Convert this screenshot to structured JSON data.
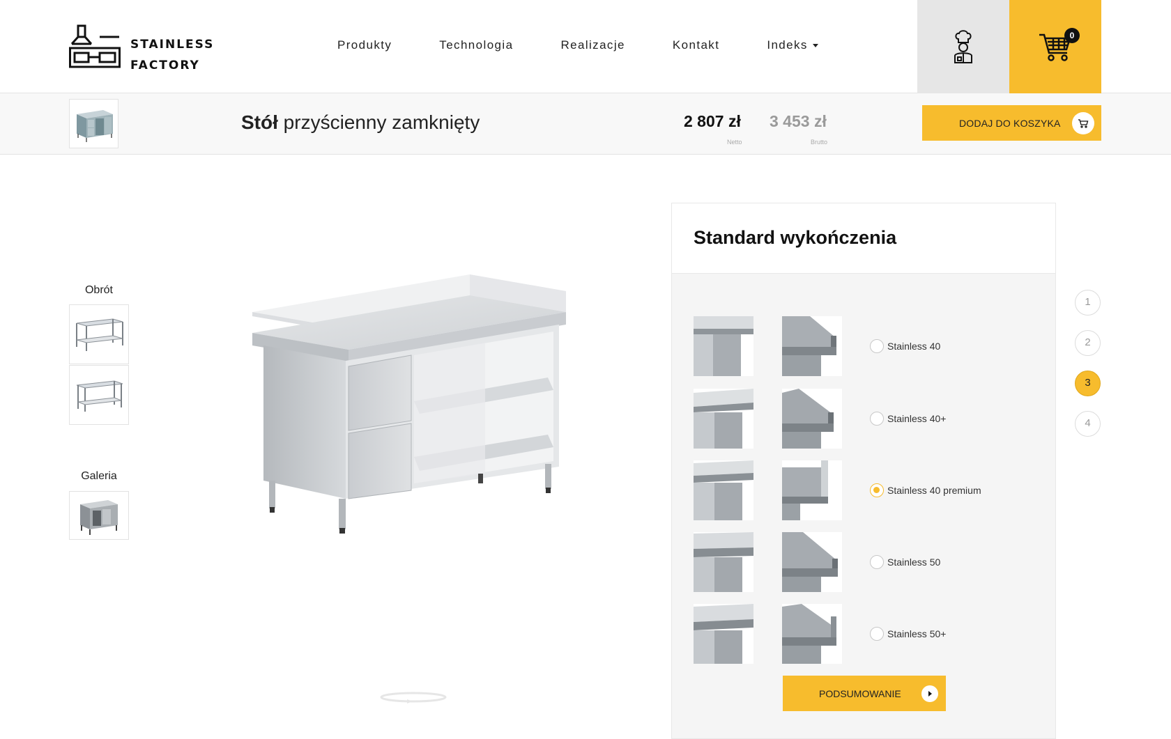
{
  "brand": {
    "name_line1": "STAINLESS",
    "name_line2": "FACTORY",
    "logo_icon": "kitchen-hood-logo"
  },
  "nav": {
    "items": [
      {
        "label": "Produkty"
      },
      {
        "label": "Technologia"
      },
      {
        "label": "Realizacje"
      },
      {
        "label": "Kontakt"
      },
      {
        "label": "Indeks",
        "has_dropdown": true
      }
    ]
  },
  "header": {
    "user_icon": "chef-icon",
    "cart_icon": "cart-icon",
    "cart_count": "0"
  },
  "product": {
    "title_bold": "Stół",
    "title_rest": "przyścienny zamknięty",
    "price_net": "2 807 zł",
    "price_net_label": "Netto",
    "price_gross": "3 453 zł",
    "price_gross_label": "Brutto",
    "add_to_cart_label": "DODAJ DO KOSZYKA"
  },
  "sidebar": {
    "rotation_label": "Obrót",
    "gallery_label": "Galeria"
  },
  "config": {
    "title": "Standard wykończenia",
    "options": [
      {
        "label": "Stainless 40",
        "selected": false
      },
      {
        "label": "Stainless 40+",
        "selected": false
      },
      {
        "label": "Stainless 40 premium",
        "selected": true
      },
      {
        "label": "Stainless 50",
        "selected": false
      },
      {
        "label": "Stainless 50+",
        "selected": false
      }
    ],
    "summary_label": "PODSUMOWANIE"
  },
  "steps": {
    "items": [
      "1",
      "2",
      "3",
      "4"
    ],
    "active": "3"
  },
  "colors": {
    "accent": "#f7bc2d",
    "user_box_bg": "#e6e6e6",
    "panel_bg": "#f5f5f5"
  }
}
